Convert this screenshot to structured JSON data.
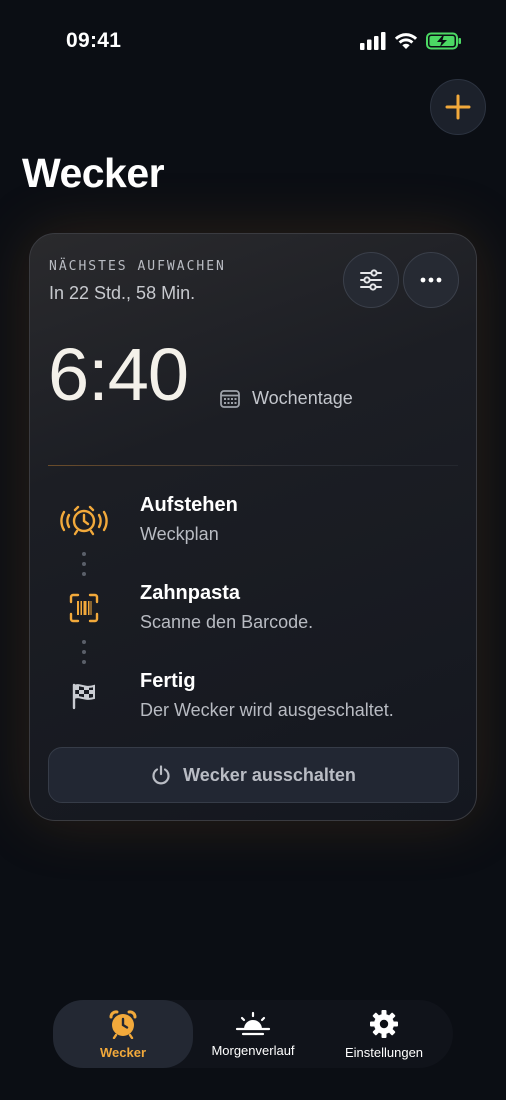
{
  "status": {
    "time": "09:41"
  },
  "header": {
    "title": "Wecker"
  },
  "card": {
    "next_label": "NÄCHSTES AUFWACHEN",
    "next_sub": "In 22 Std., 58 Min.",
    "alarm_time": "6:40",
    "repeat": "Wochentage",
    "steps": [
      {
        "title": "Aufstehen",
        "subtitle": "Weckplan",
        "icon": "alarm-ringing-icon"
      },
      {
        "title": "Zahnpasta",
        "subtitle": "Scanne den Barcode.",
        "icon": "barcode-scan-icon"
      },
      {
        "title": "Fertig",
        "subtitle": "Der Wecker wird ausgeschaltet.",
        "icon": "checkered-flag-icon"
      }
    ],
    "off_button": "Wecker ausschalten"
  },
  "tabs": [
    {
      "label": "Wecker",
      "icon": "alarm-clock-icon",
      "active": true
    },
    {
      "label": "Morgenverlauf",
      "icon": "sunrise-icon",
      "active": false
    },
    {
      "label": "Einstellungen",
      "icon": "gear-icon",
      "active": false
    }
  ],
  "colors": {
    "accent": "#f2a93b",
    "background": "#0b0e14",
    "card": "#1c1e24",
    "battery": "#4cd964"
  }
}
